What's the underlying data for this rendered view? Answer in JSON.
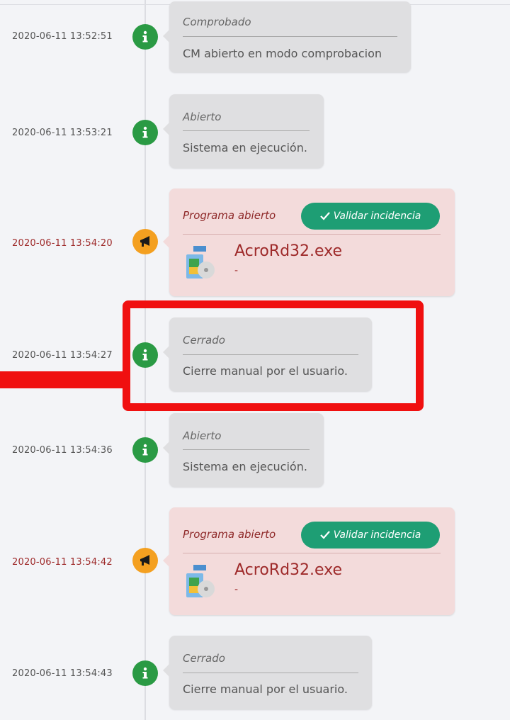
{
  "entries": [
    {
      "timestamp": "2020-06-11 13:52:51",
      "status": "info",
      "title": "Comprobado",
      "message": "CM abierto en modo comprobacion"
    },
    {
      "timestamp": "2020-06-11 13:53:21",
      "status": "info",
      "title": "Abierto",
      "message": "Sistema en ejecución."
    },
    {
      "timestamp": "2020-06-11 13:54:20",
      "status": "alert",
      "title": "Programa abierto",
      "button": "Validar incidencia",
      "program": "AcroRd32.exe",
      "program_detail": "-",
      "program_icon": "acrobat-reader-icon"
    },
    {
      "timestamp": "2020-06-11 13:54:27",
      "status": "info",
      "title": "Cerrado",
      "message": "Cierre manual por el usuario."
    },
    {
      "timestamp": "2020-06-11 13:54:36",
      "status": "info",
      "title": "Abierto",
      "message": "Sistema en ejecución."
    },
    {
      "timestamp": "2020-06-11 13:54:42",
      "status": "alert",
      "title": "Programa abierto",
      "button": "Validar incidencia",
      "program": "AcroRd32.exe",
      "program_detail": "-",
      "program_icon": "acrobat-reader-icon"
    },
    {
      "timestamp": "2020-06-11 13:54:43",
      "status": "info",
      "title": "Cerrado",
      "message": "Cierre manual por el usuario."
    }
  ],
  "icons": {
    "info": "info-icon",
    "alert": "megaphone-icon",
    "check": "check-icon"
  },
  "colors": {
    "info_badge": "#2a9a44",
    "alert_badge": "#f4a020",
    "alert_card": "#f3dbdb",
    "info_card": "#dfdfe1",
    "validate_button": "#1e9e74",
    "highlight": "#f01010",
    "alert_text": "#9e2a2a"
  }
}
